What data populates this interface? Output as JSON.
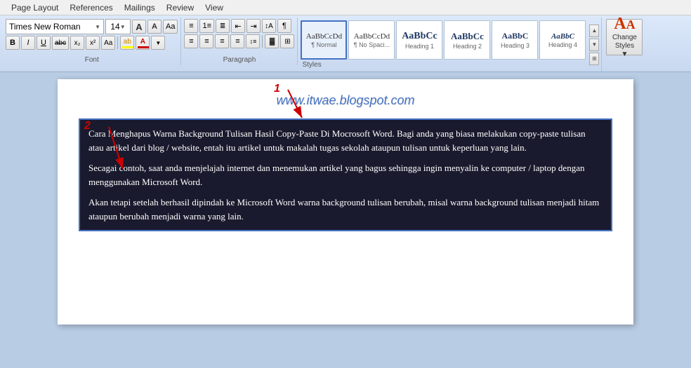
{
  "menu": {
    "items": [
      "Page Layout",
      "References",
      "Mailings",
      "Review",
      "View"
    ]
  },
  "ribbon": {
    "font": {
      "name": "Times New Roman",
      "size": "14",
      "grow_label": "A",
      "shrink_label": "A",
      "clear_label": "Aa"
    },
    "format_buttons": {
      "bold": "B",
      "italic": "I",
      "underline": "U",
      "strikethrough": "abc",
      "subscript": "x₂",
      "superscript": "x²",
      "change_case": "Aa"
    },
    "paragraph_label": "Paragraph",
    "font_label": "Font",
    "styles_label": "Styles",
    "styles": [
      {
        "label": "¶ Normal",
        "preview": "AaBbCcDd",
        "active": true
      },
      {
        "label": "¶ No Spaci...",
        "preview": "AaBbCcDd",
        "active": false
      },
      {
        "label": "Heading 1",
        "preview": "AaBbCc",
        "active": false,
        "type": "h1"
      },
      {
        "label": "Heading 2",
        "preview": "AaBbCc",
        "active": false,
        "type": "h2"
      },
      {
        "label": "Heading 3",
        "preview": "AaBbC",
        "active": false,
        "type": "h3"
      },
      {
        "label": "Heading 4",
        "preview": "AaBbC",
        "active": false,
        "type": "h4"
      }
    ],
    "change_styles": "Change\nStyles",
    "change_styles_icon": "AA"
  },
  "document": {
    "watermark": "www.itwae.blogspot.com",
    "paragraphs": [
      "Cara Menghapus Warna Background Tulisan Hasil Copy-Paste Di Mocrosoft Word. Bagi anda yang biasa melakukan copy-paste tulisan atau artikel dari blog / website, entah itu artikel untuk makalah tugas sekolah ataupun tulisan untuk keperluan yang lain.",
      "Secagai contoh, saat anda menjelajah internet dan menemukan artikel yang bagus sehingga ingin menyalin ke computer / laptop dengan menggunakan Microsoft Word.",
      "Akan tetapi setelah berhasil dipindah ke Microsoft Word warna background tulisan berubah, misal warna background tulisan menjadi hitam ataupun berubah menjadi warna yang lain."
    ]
  },
  "annotations": {
    "arrow1_label": "1",
    "arrow2_label": "2"
  }
}
